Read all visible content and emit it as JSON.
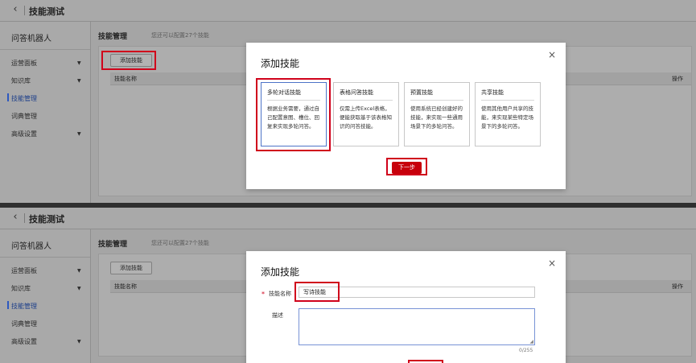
{
  "page_title": "技能测试",
  "sidebar": {
    "title": "问答机器人",
    "items": [
      {
        "label": "运营面板",
        "caret": "▼"
      },
      {
        "label": "知识库",
        "caret": "▼"
      },
      {
        "label": "技能管理"
      },
      {
        "label": "词典管理"
      },
      {
        "label": "高级设置",
        "caret": "▼"
      }
    ],
    "active": "技能管理"
  },
  "main": {
    "heading": "技能管理",
    "heading_note": "您还可以配置27个技能",
    "add_button": "添加技能",
    "table_headers": [
      "技能名称",
      "操作"
    ]
  },
  "dialog1": {
    "title": "添加技能",
    "close": "×",
    "tiles": [
      {
        "title": "多轮对话技能",
        "desc": "根据业务需要，通过自己配置意图、槽位、回复来实现多轮问答。"
      },
      {
        "title": "表格问答技能",
        "desc": "仅需上传Excel表格，便能获取基于该表格知识的问答技能。"
      },
      {
        "title": "预置技能",
        "desc": "使用系统已经创建好的技能，来实现一些通用场景下的多轮问答。"
      },
      {
        "title": "共享技能",
        "desc": "使用其他用户共享的技能，来实现某些特定场景下的多轮问答。"
      }
    ],
    "next_button": "下一步"
  },
  "dialog2": {
    "title": "添加技能",
    "close": "×",
    "required_mark": "*",
    "name_label": "技能名称",
    "name_value": "写诗技能",
    "desc_label": "描述",
    "desc_value": "",
    "counter": "0/255"
  },
  "colors": {
    "highlight": "#d0021b",
    "primary": "#c7000b",
    "active": "#2d58c0"
  },
  "icons": {
    "back": "chevron-left-icon",
    "close": "close-icon",
    "caret": "caret-down-icon",
    "resize": "resize-grip-icon"
  }
}
